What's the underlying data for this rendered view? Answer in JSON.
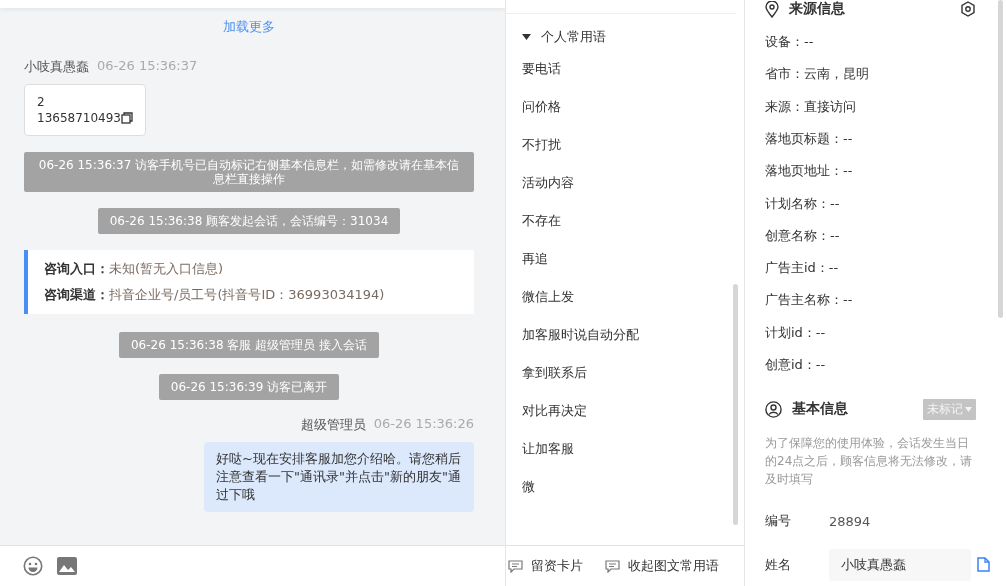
{
  "chat": {
    "load_more": "加载更多",
    "messages": [
      {
        "kind": "visitor",
        "name": "小吱真愚蠢",
        "time": "06-26 15:36:37",
        "lines": [
          "2",
          "13658710493"
        ]
      },
      {
        "kind": "system",
        "text": "06-26 15:36:37 访客手机号已自动标记右侧基本信息栏，如需修改请在基本信息栏直接操作"
      },
      {
        "kind": "system",
        "text": "06-26 15:36:38 顾客发起会话，会话编号：31034"
      },
      {
        "kind": "entry",
        "rows": [
          {
            "label": "咨询入口：",
            "value": "未知(暂无入口信息)"
          },
          {
            "label": "咨询渠道：",
            "value": "抖音企业号/员工号(抖音号ID：36993034194)"
          }
        ]
      },
      {
        "kind": "system",
        "text": "06-26 15:36:38 客服 超级管理员 接入会话"
      },
      {
        "kind": "system",
        "text": "06-26 15:36:39 访客已离开"
      },
      {
        "kind": "agent",
        "name": "超级管理员",
        "time": "06-26 15:36:26",
        "text": "好哒~现在安排客服加您介绍哈。请您稍后注意查看一下\"通讯录\"并点击\"新的朋友\"通过下哦"
      }
    ]
  },
  "phrases": {
    "group": "个人常用语",
    "expanded": true,
    "items": [
      "要电话",
      "问价格",
      "不打扰",
      "活动内容",
      "不存在",
      "再追",
      "微信上发",
      "加客服时说自动分配",
      "拿到联系后",
      "对比再决定",
      "让加客服",
      "微"
    ],
    "footer": [
      "留资卡片",
      "收起图文常用语"
    ]
  },
  "info": {
    "source_title": "来源信息",
    "source_fields": [
      "设备：--",
      "省市：云南，昆明",
      "来源：直接访问",
      "落地页标题：--",
      "落地页地址：--",
      "计划名称：--",
      "创意名称：--",
      "广告主id：--",
      "广告主名称：--",
      "计划id：--",
      "创意id：--"
    ],
    "basic_title": "基本信息",
    "tag": "未标记",
    "notice": "为了保障您的使用体验，会话发生当日的24点之后，顾客信息将无法修改，请及时填写",
    "fields": [
      {
        "kind": "text",
        "label": "编号",
        "value": "28894"
      },
      {
        "kind": "input",
        "label": "姓名",
        "value": "小吱真愚蠢"
      }
    ]
  }
}
